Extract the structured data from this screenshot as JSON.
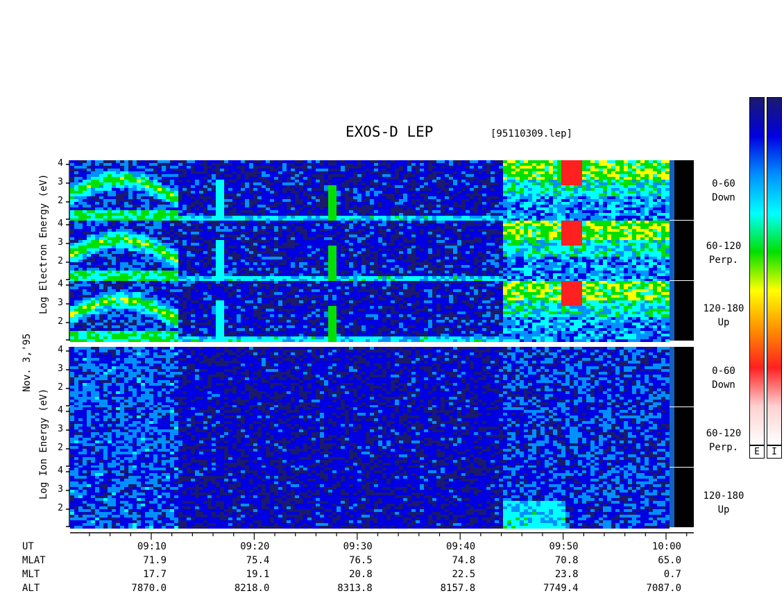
{
  "title": "EXOS-D LEP",
  "subtitle": "[95110309.lep]",
  "date_label": "Nov. 3,'95",
  "electron_axis_label": "Log Electron Energy (eV)",
  "ion_axis_label": "Log Ion Energy (eV)",
  "panels": [
    {
      "species": "electron",
      "label": "0-60\nDown"
    },
    {
      "species": "electron",
      "label": "60-120\nPerp."
    },
    {
      "species": "electron",
      "label": "120-180\nUp"
    },
    {
      "species": "ion",
      "label": "0-60\nDown"
    },
    {
      "species": "ion",
      "label": "60-120\nPerp."
    },
    {
      "species": "ion",
      "label": "120-180\nUp"
    }
  ],
  "y_ticks": [
    "4",
    "3",
    "2"
  ],
  "colorbar_labels": [
    "E",
    "I"
  ],
  "colors": {
    "background_plot": "#000000",
    "colormap": [
      "#ffffff",
      "#ff2020",
      "#ff9000",
      "#ffff00",
      "#00e000",
      "#00ffff",
      "#0090ff",
      "#0000e0",
      "#1a1a6e"
    ]
  },
  "time_table": {
    "row_labels": [
      "UT",
      "MLAT",
      "MLT",
      "ALT"
    ],
    "columns": [
      {
        "UT": "09:10",
        "MLAT": "71.9",
        "MLT": "17.7",
        "ALT": "7870.0"
      },
      {
        "UT": "09:20",
        "MLAT": "75.4",
        "MLT": "19.1",
        "ALT": "8218.0"
      },
      {
        "UT": "09:30",
        "MLAT": "76.5",
        "MLT": "20.8",
        "ALT": "8313.8"
      },
      {
        "UT": "09:40",
        "MLAT": "74.8",
        "MLT": "22.5",
        "ALT": "8157.8"
      },
      {
        "UT": "09:50",
        "MLAT": "70.8",
        "MLT": "23.8",
        "ALT": "7749.4"
      },
      {
        "UT": "10:00",
        "MLAT": "65.0",
        "MLT": "0.7",
        "ALT": "7087.0"
      }
    ]
  },
  "chart_data": {
    "type": "heatmap",
    "title": "EXOS-D LEP",
    "subtitle": "[95110309.lep]",
    "x_unit": "UT",
    "x_ticks": [
      "09:10",
      "09:20",
      "09:30",
      "09:40",
      "09:50",
      "10:00"
    ],
    "xlim": [
      "09:02",
      "10:02"
    ],
    "ylim": [
      1,
      4.2
    ],
    "ylabel_electron": "Log Electron Energy (eV)",
    "ylabel_ion": "Log Ion Energy (eV)",
    "series": [
      {
        "name": "0-60 Down",
        "species": "electron"
      },
      {
        "name": "60-120 Perp.",
        "species": "electron"
      },
      {
        "name": "120-180 Up",
        "species": "electron"
      },
      {
        "name": "0-60 Down",
        "species": "ion"
      },
      {
        "name": "60-120 Perp.",
        "species": "ion"
      },
      {
        "name": "120-180 Up",
        "species": "ion"
      }
    ],
    "data_gap_after": "10:01",
    "dense_plasma_start": "09:44"
  }
}
